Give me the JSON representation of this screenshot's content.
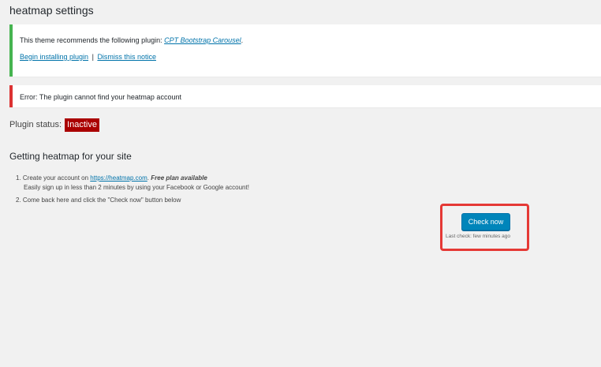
{
  "page": {
    "title": "heatmap settings"
  },
  "notice_warning": {
    "text": "This theme recommends the following plugin:",
    "plugin_link": "CPT Bootstrap Carousel",
    "after_link": ".",
    "install_link": "Begin installing plugin",
    "separator": "|",
    "dismiss_link": "Dismiss this notice"
  },
  "notice_error": {
    "text": "Error: The plugin cannot find your heatmap account"
  },
  "status": {
    "label": "Plugin status:",
    "value": "Inactive"
  },
  "section": {
    "title": "Getting heatmap for your site"
  },
  "steps": {
    "step1_prefix": "1. Create your account on",
    "step1_link": "https://heatmap.com",
    "step1_dot": ".",
    "step1_bold": "Free plan available",
    "step1_sub": "Easily sign up in less than 2 minutes by using your Facebook or Google account!",
    "step2": "2. Come back here and click the \"Check now\" button below"
  },
  "check": {
    "button_label": "Check now",
    "last_check": "Last check: few minutes ago"
  },
  "colors": {
    "background": "#f1f1f1",
    "notice_warning_border": "#46b450",
    "notice_error_border": "#dc3232",
    "badge_bg": "#aa0000",
    "button_bg": "#0085ba",
    "link": "#0073aa",
    "highlight_border": "#e53935"
  }
}
